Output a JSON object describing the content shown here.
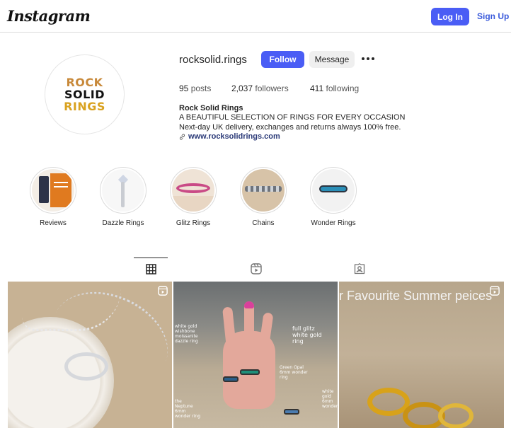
{
  "header": {
    "logo": "Instagram",
    "login_label": "Log In",
    "signup_label": "Sign Up"
  },
  "profile": {
    "avatar_lines": [
      "ROCK",
      "SOLID",
      "RINGS"
    ],
    "username": "rocksolid.rings",
    "follow_label": "Follow",
    "message_label": "Message",
    "stats": {
      "posts_count": "95",
      "posts_label": "posts",
      "followers_count": "2,037",
      "followers_label": "followers",
      "following_count": "411",
      "following_label": "following"
    },
    "bio": {
      "name": "Rock Solid Rings",
      "line1": "A BEAUTIFUL SELECTION OF RINGS FOR EVERY OCCASION",
      "line2": "Next-day UK delivery, exchanges and returns always 100% free.",
      "link": "www.rocksolidrings.com"
    }
  },
  "highlights": [
    {
      "label": "Reviews"
    },
    {
      "label": "Dazzle Rings"
    },
    {
      "label": "Glitz Rings"
    },
    {
      "label": "Chains"
    },
    {
      "label": "Wonder Rings"
    }
  ],
  "tabs": [
    {
      "icon": "grid-icon",
      "active": true
    },
    {
      "icon": "reels-icon",
      "active": false
    },
    {
      "icon": "tagged-icon",
      "active": false
    }
  ],
  "posts": [
    {
      "overlay_text": ""
    },
    {
      "overlay_text": "",
      "annotations": [
        "white gold wishbone moissanite dazzle ring",
        "full glitz white gold ring",
        "Green Opal 6mm wonder ring",
        "the Neptune 6mm wonder ring",
        "white gold 6mm wonder"
      ]
    },
    {
      "overlay_text": "r Favourite Summer peices"
    }
  ],
  "colors": {
    "accent": "#4a5df5",
    "link": "#2b3a78",
    "border": "#dbdbdb"
  }
}
